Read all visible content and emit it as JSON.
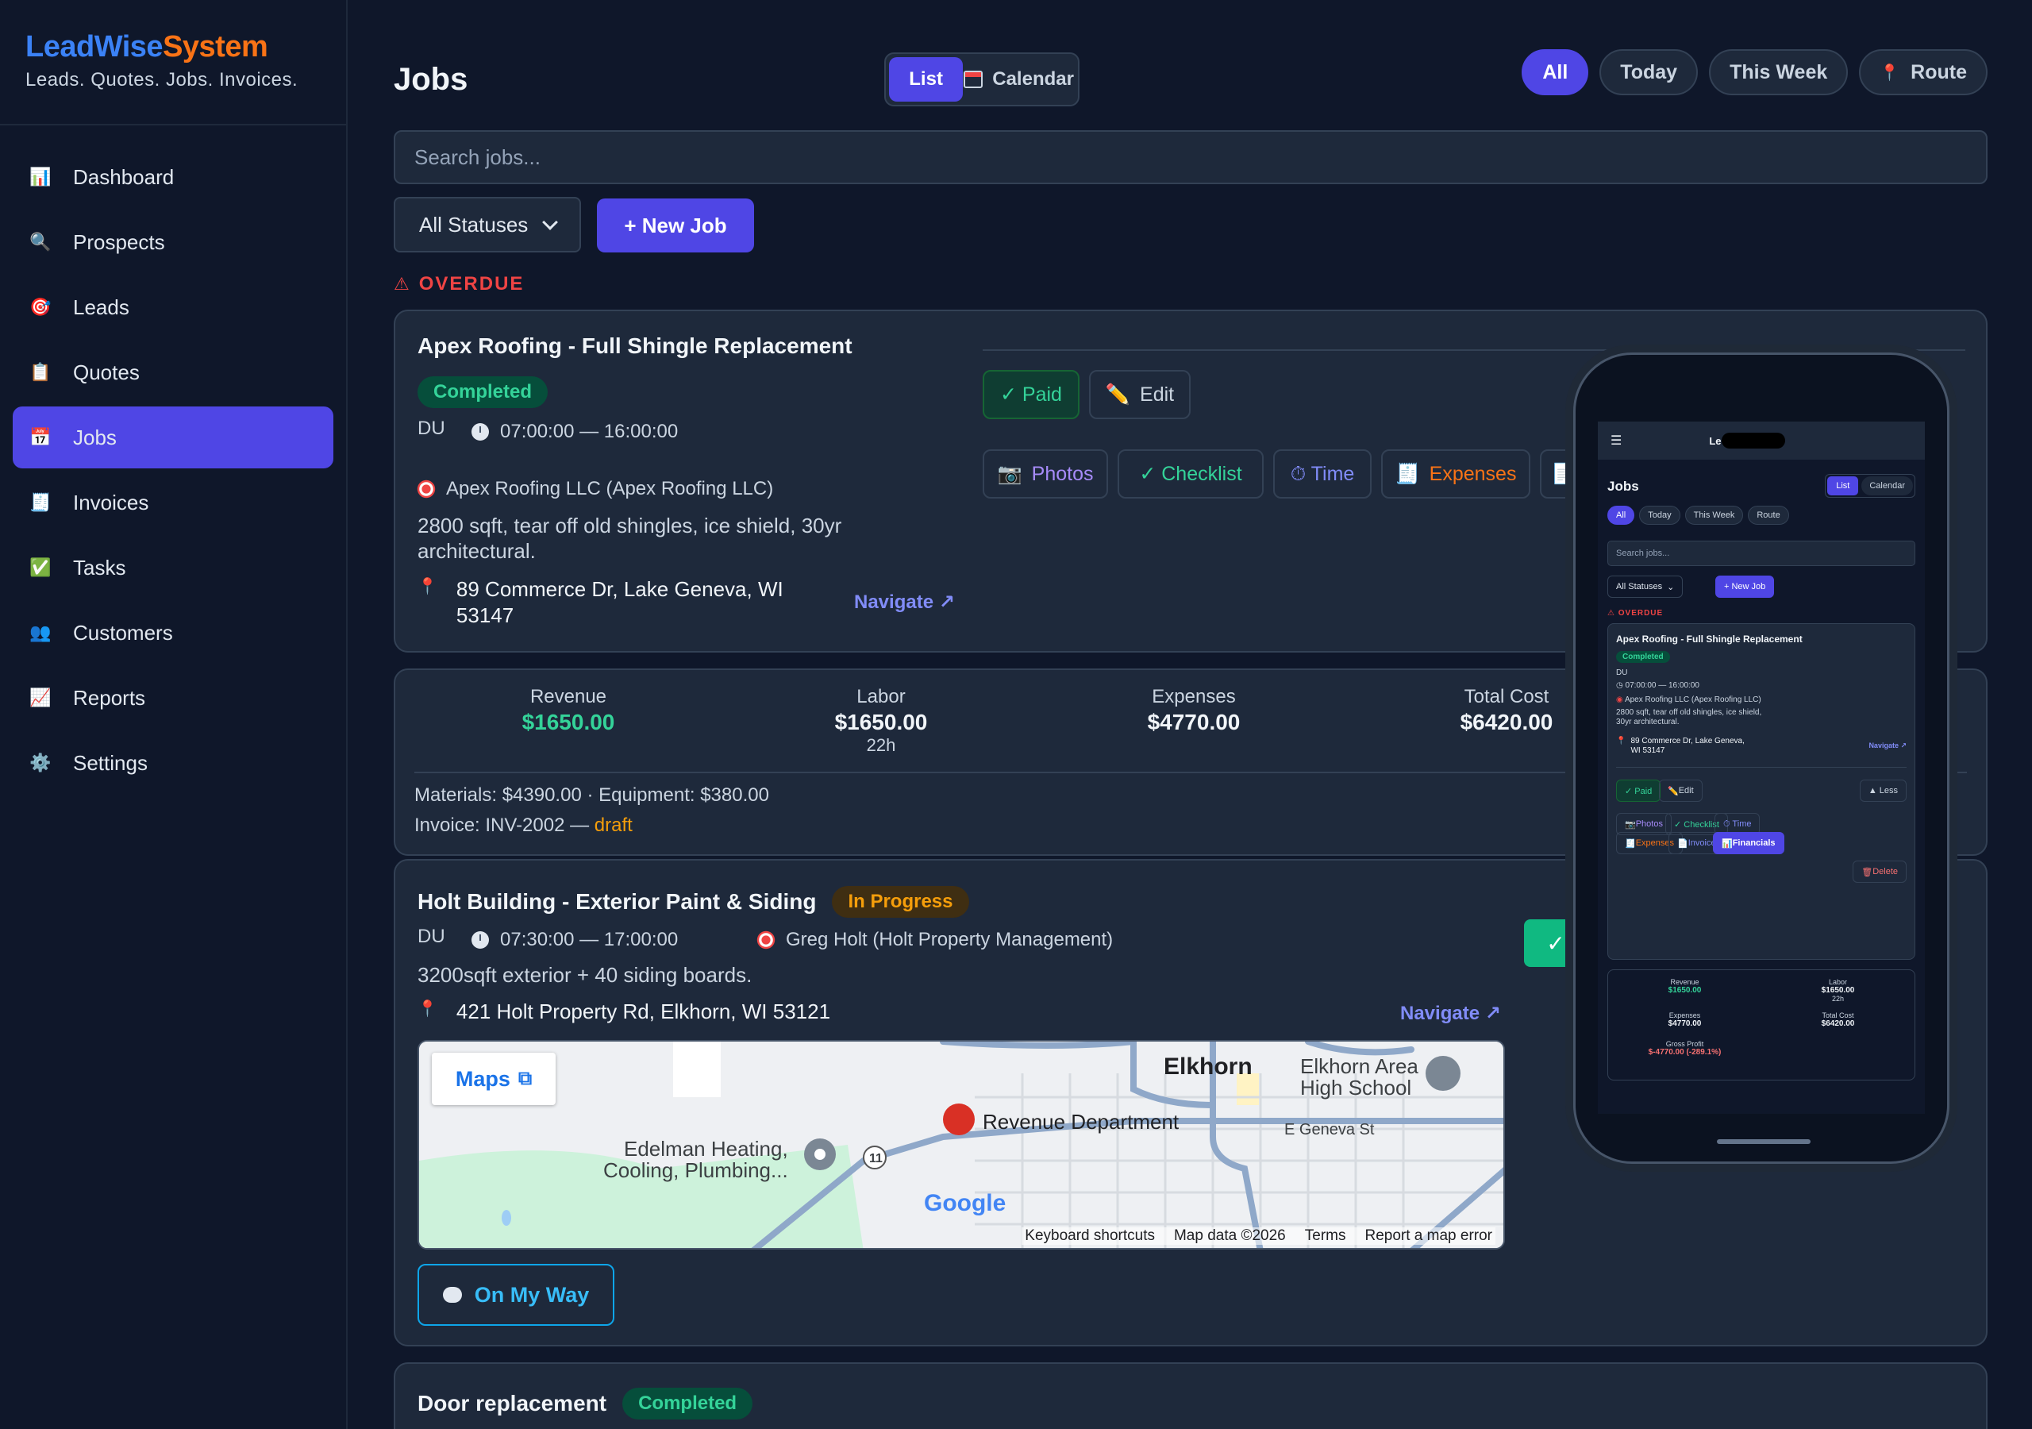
{
  "brand": {
    "part1": "LeadWise",
    "part2": "System",
    "tagline": "Leads. Quotes. Jobs. Invoices."
  },
  "nav": [
    {
      "label": "Dashboard",
      "icon": "📊"
    },
    {
      "label": "Prospects",
      "icon": "🔍"
    },
    {
      "label": "Leads",
      "icon": "🎯"
    },
    {
      "label": "Quotes",
      "icon": "📋"
    },
    {
      "label": "Jobs",
      "icon": "📅"
    },
    {
      "label": "Invoices",
      "icon": "🧾"
    },
    {
      "label": "Tasks",
      "icon": "✅"
    },
    {
      "label": "Customers",
      "icon": "👥"
    },
    {
      "label": "Reports",
      "icon": "📈"
    },
    {
      "label": "Settings",
      "icon": "⚙️"
    }
  ],
  "header": {
    "title": "Jobs",
    "view_list": "List",
    "view_calendar": "Calendar"
  },
  "filters": {
    "all": "All",
    "today": "Today",
    "week": "This Week",
    "route": "Route"
  },
  "search": {
    "placeholder": "Search jobs..."
  },
  "status_select": {
    "value": "All Statuses"
  },
  "new_job": "+ New Job",
  "overdue_label": "OVERDUE",
  "job1": {
    "title": "Apex Roofing - Full Shingle Replacement",
    "status": "Completed",
    "crew": "DU",
    "time": "07:00:00 — 16:00:00",
    "customer": "Apex Roofing LLC (Apex Roofing LLC)",
    "description": "2800 sqft, tear off old shingles, ice shield, 30yr architectural.",
    "address": "89 Commerce Dr, Lake Geneva, WI 53147",
    "navigate": "Navigate ↗",
    "btn_paid": "✓ Paid",
    "btn_edit": "Edit",
    "btn_photos": "Photos",
    "btn_checklist": "✓ Checklist",
    "btn_time": "⏱ Time",
    "btn_expenses": "Expenses"
  },
  "financials": {
    "revenue_label": "Revenue",
    "revenue": "$1650.00",
    "labor_label": "Labor",
    "labor": "$1650.00",
    "labor_hours": "22h",
    "expenses_label": "Expenses",
    "expenses": "$4770.00",
    "total_label": "Total Cost",
    "total": "$6420.00",
    "materials_line": "Materials: $4390.00 · Equipment: $380.00",
    "invoice_prefix": "Invoice: INV-2002 — ",
    "invoice_status": "draft"
  },
  "job2": {
    "title": "Holt Building - Exterior Paint & Siding",
    "status": "In Progress",
    "crew": "DU",
    "time": "07:30:00 — 17:00:00",
    "customer": "Greg Holt (Holt Property Management)",
    "description": "3200sqft exterior + 40 siding boards.",
    "address": "421 Holt Property Rd, Elkhorn, WI 53121",
    "navigate": "Navigate ↗",
    "on_my_way": "On My Way"
  },
  "map": {
    "maps_btn": "Maps",
    "labels": {
      "elkhorn": "Elkhorn",
      "school": "Elkhorn Area\nHigh School",
      "revenue": "Revenue Department",
      "edelman": "Edelman Heating,\nCooling, Plumbing...",
      "geneva": "E Geneva St",
      "route": "11",
      "google": "Google"
    },
    "footer": [
      "Keyboard shortcuts",
      "Map data ©2026",
      "Terms",
      "Report a map error"
    ]
  },
  "job3": {
    "title": "Door replacement",
    "status": "Completed"
  },
  "phone": {
    "app_name": "Le            m",
    "title": "Jobs",
    "list": "List",
    "calendar": "Calendar",
    "pills": [
      "All",
      "Today",
      "This Week",
      "Route"
    ],
    "search": "Search jobs...",
    "status": "All Statuses",
    "new_job": "+ New Job",
    "overdue": "⚠ OVERDUE",
    "job_title": "Apex Roofing - Full Shingle Replacement",
    "job_status": "Completed",
    "crew": "DU",
    "time": "07:00:00 — 16:00:00",
    "customer": "Apex Roofing LLC (Apex Roofing LLC)",
    "description": "2800 sqft, tear off old shingles, ice shield, 30yr architectural.",
    "address": "89 Commerce Dr, Lake Geneva, WI 53147",
    "navigate": "Navigate ↗",
    "paid": "✓ Paid",
    "edit": "Edit",
    "less": "▲ Less",
    "photos": "Photos",
    "checklist": "✓ Checklist",
    "time_btn": "⏱ Time",
    "expenses": "Expenses",
    "invoice": "Invoice",
    "financials": "Financials",
    "delete": "Delete",
    "revenue_label": "Revenue",
    "revenue": "$1650.00",
    "labor_label": "Labor",
    "labor": "$1650.00",
    "labor_hours": "22h",
    "expenses_label": "Expenses",
    "expenses_val": "$4770.00",
    "total_label": "Total Cost",
    "total": "$6420.00",
    "gp_label": "Gross Profit",
    "gp": "$-4770.00 (-289.1%)"
  }
}
